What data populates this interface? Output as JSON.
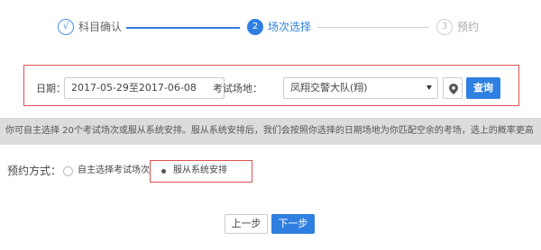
{
  "stepper": {
    "steps": [
      {
        "index": "√",
        "label": "科目确认",
        "state": "done"
      },
      {
        "index": "2",
        "label": "场次选择",
        "state": "active"
      },
      {
        "index": "3",
        "label": "预约",
        "state": "pending"
      }
    ]
  },
  "query": {
    "date_label": "日期：",
    "date_value": "2017-05-29至2017-06-08",
    "site_label": "考试场地：",
    "site_value": "凤翔交警大队(翔)",
    "query_button": "查询"
  },
  "info": {
    "text": "你可自主选择 20个考试场次或服从系统安排。服从系统安排后，我们会按照你选择的日期场地为你匹配空余的考场，选上的概率更高"
  },
  "method": {
    "label": "预约方式：",
    "options": [
      {
        "label": "自主选择考试场次",
        "selected": false
      },
      {
        "label": "服从系统安排",
        "selected": true
      }
    ]
  },
  "footer": {
    "prev_label": "上一步",
    "next_label": "下一步"
  },
  "colors": {
    "accent": "#2f7fe0",
    "highlight_border": "#e05252",
    "strip_bg": "#dcdcdc"
  }
}
